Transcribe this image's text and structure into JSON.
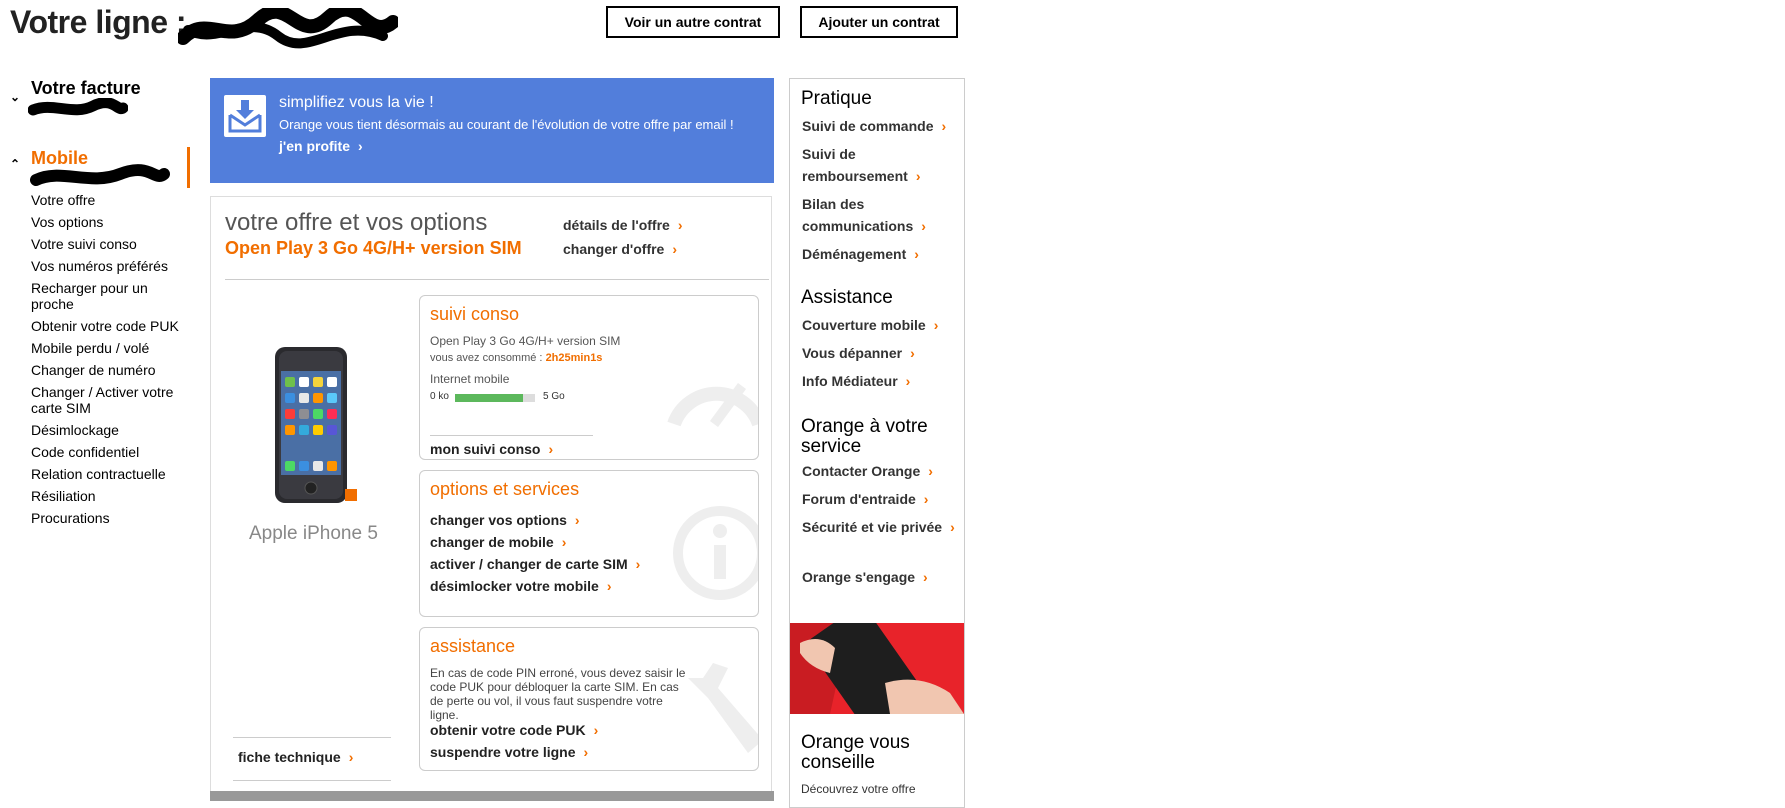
{
  "header": {
    "title": "Votre ligne :",
    "btn_other_contract": "Voir un autre contrat",
    "btn_add_contract": "Ajouter un contrat"
  },
  "nav": {
    "facture_label": "Votre facture",
    "mobile_label": "Mobile",
    "items": [
      "Votre offre",
      "Vos options",
      "Votre suivi conso",
      "Vos numéros préférés",
      "Recharger pour un proche",
      "Obtenir votre code PUK",
      "Mobile perdu / volé",
      "Changer de numéro",
      "Changer / Activer votre carte SIM",
      "Désimlockage",
      "Code confidentiel",
      "Relation contractuelle",
      "Résiliation",
      "Procurations"
    ]
  },
  "promo": {
    "title": "simplifiez vous la vie !",
    "text": "Orange vous tient désormais au courant de l'évolution de votre offre par email !",
    "link": "j'en profite"
  },
  "offer": {
    "title": "votre offre et vos options",
    "name": "Open Play 3 Go 4G/H+ version SIM",
    "link_details": "détails de l'offre",
    "link_change": "changer d'offre",
    "phone_name": "Apple iPhone 5",
    "fiche_link": "fiche technique"
  },
  "conso": {
    "title": "suivi conso",
    "plan": "Open Play 3 Go 4G/H+ version SIM",
    "consumed_label": "vous avez consommé :",
    "consumed_value": "2h25min1s",
    "internet_label": "Internet mobile",
    "min_label": "0 ko",
    "max_label": "5 Go",
    "usage_fraction": 0.85,
    "link": "mon suivi conso"
  },
  "options": {
    "title": "options et services",
    "links": [
      "changer vos options",
      "changer de mobile",
      "activer / changer de carte SIM",
      "désimlocker votre mobile"
    ]
  },
  "assistance": {
    "title": "assistance",
    "text": "En cas de code PIN erroné, vous devez saisir le code PUK pour débloquer la carte SIM. En cas de perte ou vol, il vous faut suspendre votre ligne.",
    "links": [
      "obtenir votre code PUK",
      "suspendre votre ligne"
    ]
  },
  "right": {
    "pratique_head": "Pratique",
    "pratique_links": [
      "Suivi de commande",
      "Suivi de remboursement",
      "Bilan des communications",
      "Déménagement"
    ],
    "assistance_head": "Assistance",
    "assistance_links": [
      "Couverture mobile",
      "Vous dépanner",
      "Info Médiateur"
    ],
    "service_head": "Orange à votre service",
    "service_links": [
      "Contacter Orange",
      "Forum d'entraide",
      "Sécurité et vie privée",
      "Orange s'engage"
    ],
    "conseille_head": "Orange vous conseille",
    "conseille_text": "Découvrez votre offre"
  },
  "colors": {
    "accent": "#f16e00",
    "promo_bg": "#527edb",
    "gauge_fill": "#5cb85c"
  }
}
